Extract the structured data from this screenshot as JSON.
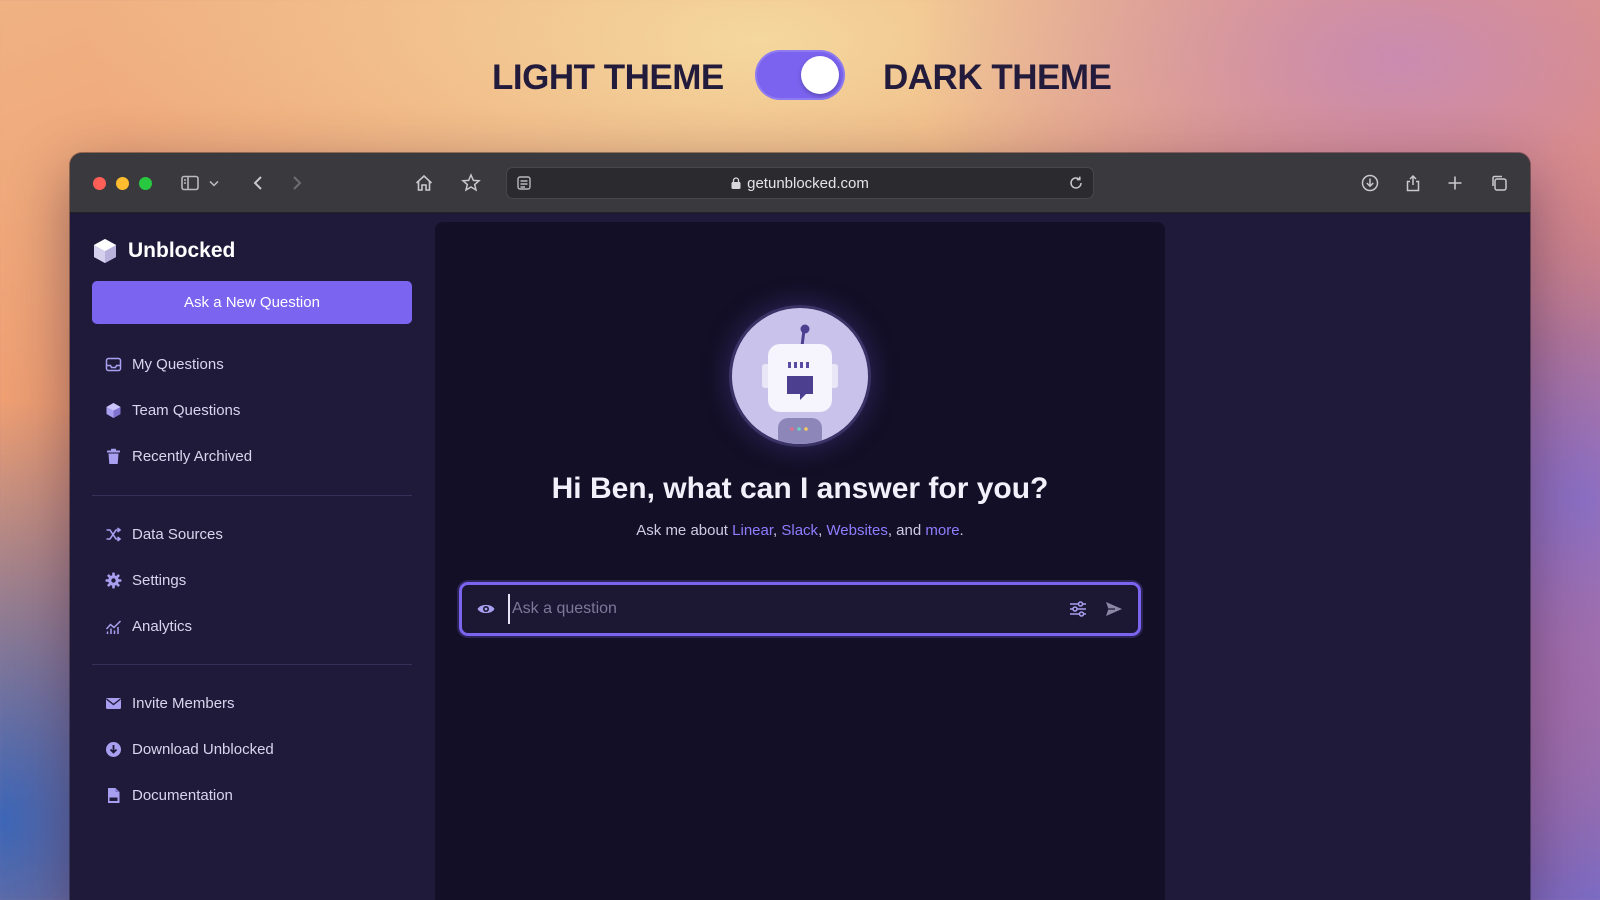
{
  "theme_toggle": {
    "light_label": "LIGHT THEME",
    "dark_label": "DARK THEME",
    "state": "dark",
    "accent": "#7b63ef"
  },
  "browser": {
    "url": "getunblocked.com",
    "icons": [
      "sidebar-icon",
      "chevron-down-icon",
      "back-icon",
      "forward-icon",
      "home-icon",
      "star-icon",
      "reader-icon",
      "lock-icon",
      "reload-icon",
      "download-icon",
      "share-icon",
      "new-tab-icon",
      "tabs-overview-icon"
    ]
  },
  "sidebar": {
    "brand": "Unblocked",
    "ask_button": "Ask a New Question",
    "groups": [
      [
        {
          "label": "My Questions",
          "icon": "inbox-icon"
        },
        {
          "label": "Team Questions",
          "icon": "cube-icon"
        },
        {
          "label": "Recently Archived",
          "icon": "trash-icon"
        }
      ],
      [
        {
          "label": "Data Sources",
          "icon": "shuffle-icon"
        },
        {
          "label": "Settings",
          "icon": "gear-icon"
        },
        {
          "label": "Analytics",
          "icon": "chart-icon"
        }
      ],
      [
        {
          "label": "Invite Members",
          "icon": "mail-icon"
        },
        {
          "label": "Download Unblocked",
          "icon": "download-circle-icon"
        },
        {
          "label": "Documentation",
          "icon": "document-icon"
        }
      ]
    ]
  },
  "main": {
    "greeting": "Hi Ben, what can I answer for you?",
    "sub_prefix": "Ask me about ",
    "sources": [
      "Linear",
      "Slack",
      "Websites"
    ],
    "sep1": ", ",
    "sep2": ", ",
    "sep3": ", and ",
    "more": "more",
    "sub_suffix": ".",
    "input_placeholder": "Ask a question",
    "input_value": ""
  },
  "colors": {
    "accent": "#7a64f0",
    "link": "#8f7dff",
    "sidebar_bg": "#1f1a3a",
    "panel_bg": "#130f26"
  }
}
